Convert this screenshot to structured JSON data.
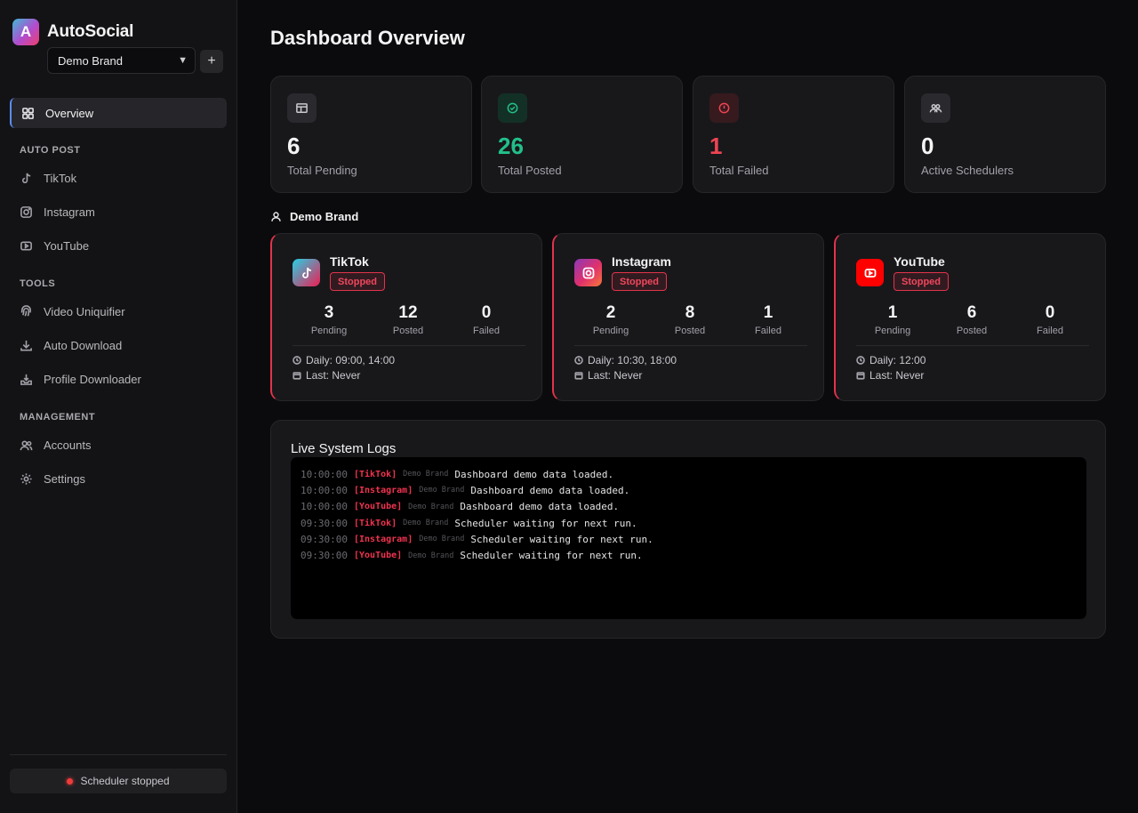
{
  "app": {
    "logo_letter": "A",
    "name": "AutoSocial"
  },
  "brand_selector": {
    "value": "Demo Brand",
    "add_label": "+"
  },
  "nav": {
    "overview": "Overview",
    "auto_post_label": "AUTO POST",
    "auto_post": [
      "TikTok",
      "Instagram",
      "YouTube"
    ],
    "tools_label": "TOOLS",
    "tools": [
      "Video Uniquifier",
      "Auto Download",
      "Profile Downloader"
    ],
    "management_label": "MANAGEMENT",
    "management": [
      "Accounts",
      "Settings"
    ]
  },
  "scheduler_status": "Scheduler stopped",
  "page_title": "Dashboard Overview",
  "stats": [
    {
      "value": "6",
      "label": "Total Pending",
      "icon": "table-icon",
      "color": "#f4f4f5"
    },
    {
      "value": "26",
      "label": "Total Posted",
      "icon": "check-circle-icon",
      "color": "#22c08a"
    },
    {
      "value": "1",
      "label": "Total Failed",
      "icon": "alert-circle-icon",
      "color": "#ef4452"
    },
    {
      "value": "0",
      "label": "Active Schedulers",
      "icon": "users-icon",
      "color": "#f4f4f5"
    }
  ],
  "brand_section": {
    "name": "Demo Brand"
  },
  "platforms": [
    {
      "name": "TikTok",
      "status": "Stopped",
      "pending": "3",
      "posted": "12",
      "failed": "0",
      "pending_label": "Pending",
      "posted_label": "Posted",
      "failed_label": "Failed",
      "daily": "Daily: 09:00, 14:00",
      "last": "Last: Never"
    },
    {
      "name": "Instagram",
      "status": "Stopped",
      "pending": "2",
      "posted": "8",
      "failed": "1",
      "pending_label": "Pending",
      "posted_label": "Posted",
      "failed_label": "Failed",
      "daily": "Daily: 10:30, 18:00",
      "last": "Last: Never"
    },
    {
      "name": "YouTube",
      "status": "Stopped",
      "pending": "1",
      "posted": "6",
      "failed": "0",
      "pending_label": "Pending",
      "posted_label": "Posted",
      "failed_label": "Failed",
      "daily": "Daily: 12:00",
      "last": "Last: Never"
    }
  ],
  "logs": {
    "title": "Live System Logs",
    "entries": [
      {
        "time": "10:00:00",
        "tag": "[TikTok]",
        "brand": "Demo Brand",
        "message": "Dashboard demo data loaded."
      },
      {
        "time": "10:00:00",
        "tag": "[Instagram]",
        "brand": "Demo Brand",
        "message": "Dashboard demo data loaded."
      },
      {
        "time": "10:00:00",
        "tag": "[YouTube]",
        "brand": "Demo Brand",
        "message": "Dashboard demo data loaded."
      },
      {
        "time": "09:30:00",
        "tag": "[TikTok]",
        "brand": "Demo Brand",
        "message": "Scheduler waiting for next run."
      },
      {
        "time": "09:30:00",
        "tag": "[Instagram]",
        "brand": "Demo Brand",
        "message": "Scheduler waiting for next run."
      },
      {
        "time": "09:30:00",
        "tag": "[YouTube]",
        "brand": "Demo Brand",
        "message": "Scheduler waiting for next run."
      }
    ]
  }
}
